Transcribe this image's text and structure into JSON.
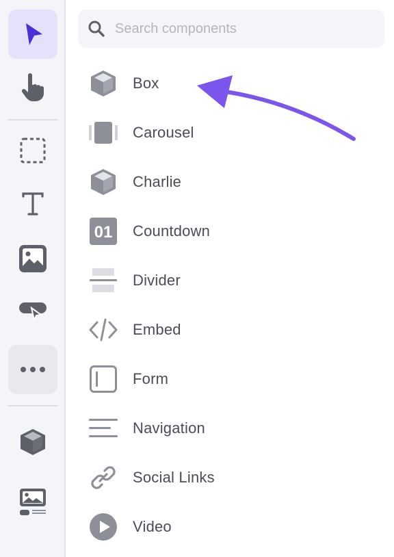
{
  "toolbar": {
    "tools": [
      {
        "icon": "pointer-icon",
        "active": true
      },
      {
        "icon": "hand-icon",
        "active": false
      },
      {
        "icon": "select-area-icon",
        "active": false
      },
      {
        "icon": "text-icon",
        "active": false
      },
      {
        "icon": "image-icon",
        "active": false
      },
      {
        "icon": "button-element-icon",
        "active": false
      },
      {
        "icon": "more-icon",
        "active": false
      },
      {
        "icon": "cube-icon",
        "active": false
      },
      {
        "icon": "media-block-icon",
        "active": false
      }
    ]
  },
  "search": {
    "placeholder": "Search components",
    "value": ""
  },
  "components": [
    {
      "label": "Box",
      "icon": "cube-icon"
    },
    {
      "label": "Carousel",
      "icon": "carousel-icon"
    },
    {
      "label": "Charlie",
      "icon": "cube-icon"
    },
    {
      "label": "Countdown",
      "icon": "countdown-icon",
      "icon_text": "01"
    },
    {
      "label": "Divider",
      "icon": "divider-icon"
    },
    {
      "label": "Embed",
      "icon": "code-icon"
    },
    {
      "label": "Form",
      "icon": "form-icon"
    },
    {
      "label": "Navigation",
      "icon": "menu-lines-icon"
    },
    {
      "label": "Social Links",
      "icon": "link-icon"
    },
    {
      "label": "Video",
      "icon": "play-icon"
    }
  ],
  "colors": {
    "accent": "#7c55ec",
    "pointer": "#4a2fd6",
    "icon_gray": "#8e9099",
    "text": "#4a4d57"
  }
}
